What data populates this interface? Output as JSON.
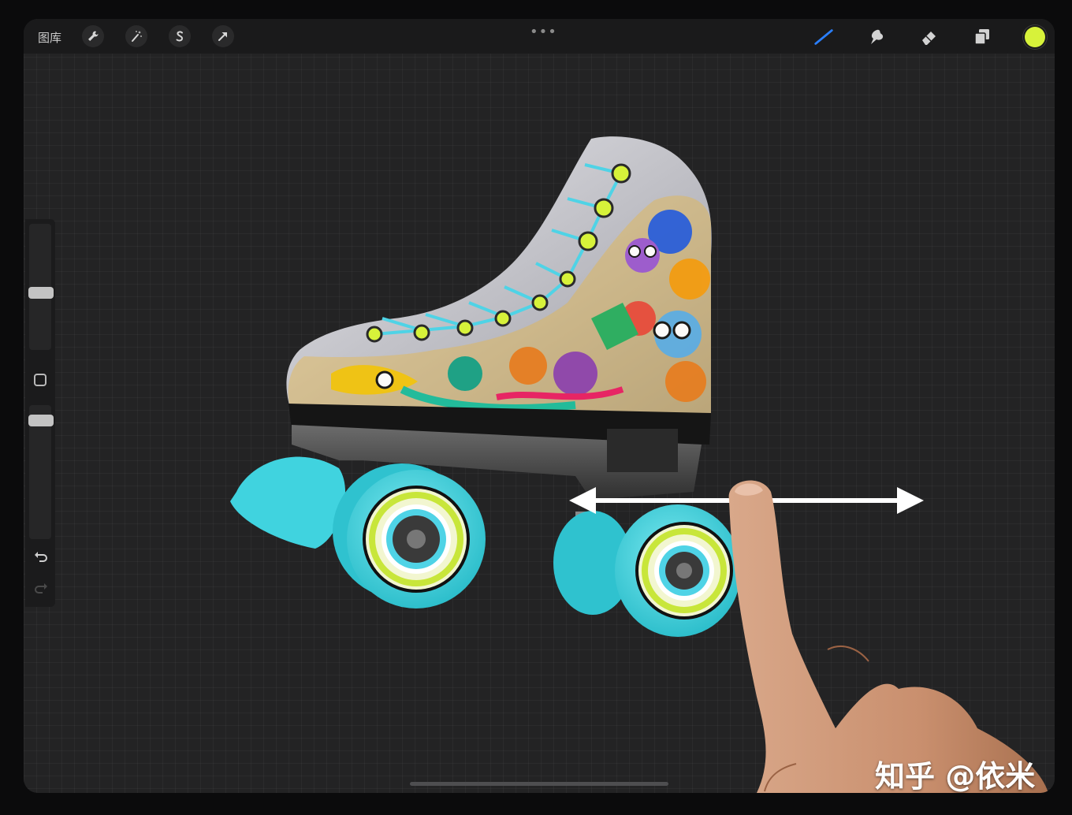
{
  "toolbar": {
    "gallery_label": "图库",
    "left_tools": [
      "wrench-icon",
      "magic-wand-icon",
      "selection-icon",
      "transform-arrow-icon"
    ],
    "more_menu": "•••",
    "right_tools": [
      "brush-icon",
      "smudge-icon",
      "eraser-icon",
      "layers-icon"
    ],
    "current_color": "#d7f23a"
  },
  "sidebar": {
    "brush_size_level": 0.45,
    "opacity_level": 0.08
  },
  "canvas": {
    "subject": "roller-skate-illustration",
    "gesture": "two-finger-horizontal-drag"
  },
  "watermark": "知乎 @依米",
  "colors": {
    "accent_lime": "#d7f23a",
    "wheel_cyan": "#3fd6e0",
    "brush_blue": "#2a7fff",
    "canvas_bg": "#232324"
  }
}
